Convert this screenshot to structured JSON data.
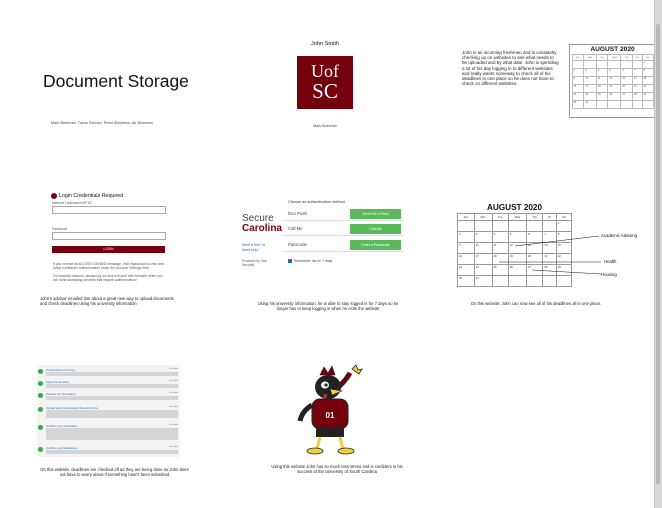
{
  "panel1": {
    "title": "Document Storage",
    "authors": "Mark Boehmer, Travis Schuler, Reed Stephens, Ali Simmons"
  },
  "panel2": {
    "name": "John Smith",
    "logo_text_top": "Uof",
    "logo_text_bottom": "SC",
    "caption": "Mark Boehmer",
    "brand_color": "#73000a"
  },
  "panel3": {
    "text": "John is an incoming freshmen and is constantly checking up on websites to see what needs to be uploaded and by what date. John is spending a lot of his day logging in to different websites and really wants someway to check all of his deadlines in one place so he does not have to check on different websites.",
    "calendar_title": "AUGUST 2020"
  },
  "panel4": {
    "heading": "Login Credentials Required",
    "field1_label": "Network Username/VIP ID",
    "field2_label": "Password",
    "button": "LOGIN",
    "note1": "If you receive an ACCESS DENIED message, visit myaccount.sc.edu and setup multifactor authentication under the Account Settings field.",
    "note2": "For security reasons, please log out and exit your web browser when you are done accessing services that require authentication!",
    "caption": "John's advisor emailed him about a great new way to upload documents and check deadlines using his university information"
  },
  "panel5": {
    "brand_top": "Secure",
    "brand_bottom": "Carolina",
    "header": "Choose an authentication method",
    "methods": [
      {
        "label": "Duo Push",
        "button": "Send Me a Push"
      },
      {
        "label": "Call Me",
        "button": "Call Me"
      },
      {
        "label": "Passcode",
        "button": "Enter a Passcode"
      }
    ],
    "links": [
      "What is this? ⧉",
      "Need help?"
    ],
    "powered": "Powered by Duo Security",
    "remember": "Remember me for 7 days",
    "caption": "Using his university information, he is able to stay logged in for 7 days so he longer has to keep logging in when he exits the website"
  },
  "panel6": {
    "calendar_title": "AUGUST 2020",
    "days": [
      "Sun",
      "Mon",
      "Tue",
      "Wed",
      "Thu",
      "Fri",
      "Sat"
    ],
    "weeks": [
      [
        "",
        "",
        "",
        "",
        "",
        "",
        "1"
      ],
      [
        "2",
        "3",
        "4",
        "5",
        "6",
        "7",
        "8"
      ],
      [
        "9",
        "10",
        "11",
        "12",
        "13",
        "14",
        "15"
      ],
      [
        "16",
        "17",
        "18",
        "19",
        "20",
        "21",
        "22"
      ],
      [
        "23",
        "24",
        "25",
        "26",
        "27",
        "28",
        "29"
      ],
      [
        "30",
        "31",
        "",
        "",
        "",
        "",
        ""
      ]
    ],
    "annotations": [
      "Academic Advising",
      "Health",
      "Housing"
    ],
    "caption": "On this website, John can now see all of his deadlines all in one place."
  },
  "panel7": {
    "items": [
      {
        "title": "Pre-Enrollment Survey",
        "date": "Due date"
      },
      {
        "title": "Apply for Housing",
        "date": "Due date"
      },
      {
        "title": "Prepare for Orientation",
        "date": "Due date"
      },
      {
        "title": "Upload and Immunization Record Forms",
        "date": "Due date"
      },
      {
        "title": "Confirm your Orientation",
        "date": "Due date"
      },
      {
        "title": "Confirm your Residence",
        "date": "Due date"
      }
    ],
    "caption": "On this website, deadlines are checked off as they are being done so John does not have to worry about if something hasn't been submitted"
  },
  "panel8": {
    "caption": "Using this website John has so much less stress and is confident in his success at the University of South Carolina"
  }
}
